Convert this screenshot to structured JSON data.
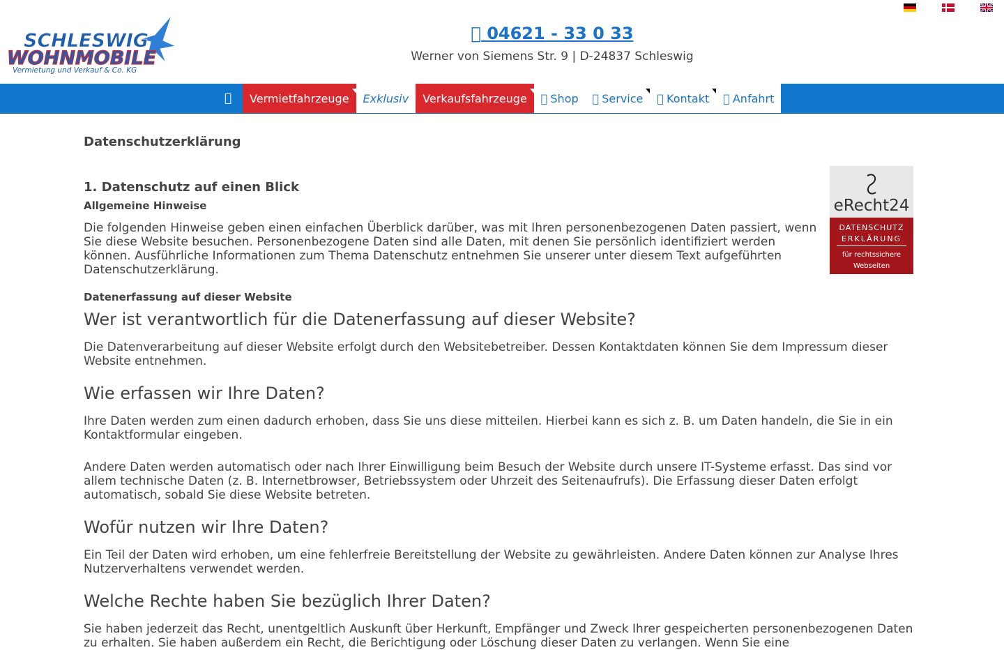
{
  "header": {
    "logo": {
      "word1": "SCHLESWIG",
      "word2": "WOHNMOBILE",
      "sub": "Vermietung und Verkauf & Co. KG",
      "colors": {
        "blue": "#1e5eb0",
        "red": "#d9272e"
      }
    },
    "phone": "04621 - 33 0 33",
    "phone_icon": "phone-icon",
    "address": "Werner von Siemens Str. 9 | D-24837 Schleswig",
    "flags": [
      "flag-de-icon",
      "flag-dk-icon",
      "flag-gb-icon"
    ]
  },
  "nav": {
    "home_icon": "home-icon",
    "items": [
      {
        "label": "Vermietfahrzeuge",
        "style": "red",
        "dropdown": true
      },
      {
        "label": "Exklusiv",
        "style": "white-italic",
        "dropdown": false
      },
      {
        "label": "Verkaufsfahrzeuge",
        "style": "red",
        "dropdown": true
      },
      {
        "label": "Shop",
        "icon": "cart-icon",
        "dropdown": false
      },
      {
        "label": "Service",
        "icon": "wrench-icon",
        "dropdown": true
      },
      {
        "label": "Kontakt",
        "icon": "envelope-icon",
        "dropdown": true
      },
      {
        "label": "Anfahrt",
        "icon": "map-marker-icon",
        "dropdown": false
      }
    ],
    "colors": {
      "bar": "#1177cc",
      "red": "#d9272e",
      "link": "#1a73c9"
    }
  },
  "content": {
    "title": "Datenschutzerklärung",
    "section1": "1. Datenschutz auf einen Blick",
    "sub1": "Allgemeine Hinweise",
    "p1": "Die folgenden Hinweise geben einen einfachen Überblick darüber, was mit Ihren personenbezogenen Daten passiert, wenn Sie diese Website besuchen. Personenbezogene Daten sind alle Daten, mit denen Sie persönlich identifiziert werden können. Ausführliche Informationen zum Thema Datenschutz entnehmen Sie unserer unter diesem Text aufgeführten Datenschutzerklärung.",
    "sub2": "Datenerfassung auf dieser Website",
    "q1": "Wer ist verantwortlich für die Datenerfassung auf dieser Website?",
    "a1": "Die Datenverarbeitung auf dieser Website erfolgt durch den Websitebetreiber. Dessen Kontaktdaten können Sie dem Impressum dieser Website entnehmen.",
    "q2": "Wie erfassen wir Ihre Daten?",
    "a2a": "Ihre Daten werden zum einen dadurch erhoben, dass Sie uns diese mitteilen. Hierbei kann es sich z. B. um Daten handeln, die Sie in ein Kontaktformular eingeben.",
    "a2b": "Andere Daten werden automatisch oder nach Ihrer Einwilligung beim Besuch der Website durch unsere IT-Systeme erfasst. Das sind vor allem technische Daten (z. B. Internetbrowser, Betriebssystem oder Uhrzeit des Seitenaufrufs). Die Erfassung dieser Daten erfolgt automatisch, sobald Sie diese Website betreten.",
    "q3": "Wofür nutzen wir Ihre Daten?",
    "a3": "Ein Teil der Daten wird erhoben, um eine fehlerfreie Bereitstellung der Website zu gewährleisten. Andere Daten können zur Analyse Ihres Nutzerverhaltens verwendet werden.",
    "q4": "Welche Rechte haben Sie bezüglich Ihrer Daten?",
    "a4": "Sie haben jederzeit das Recht, unentgeltlich Auskunft über Herkunft, Empfänger und Zweck Ihrer gespeicherten personenbezogenen Daten zu erhalten. Sie haben außerdem ein Recht, die Berichtigung oder Löschung dieser Daten zu verlangen. Wenn Sie eine"
  },
  "badge": {
    "brand": "eRecht24",
    "line1": "DATENSCHUTZ",
    "line2": "ERKLÄRUNG",
    "line3": "für rechtssichere",
    "line4": "Webseiten",
    "colors": {
      "top": "#e8e8e8",
      "bottom": "#a3161c"
    }
  }
}
